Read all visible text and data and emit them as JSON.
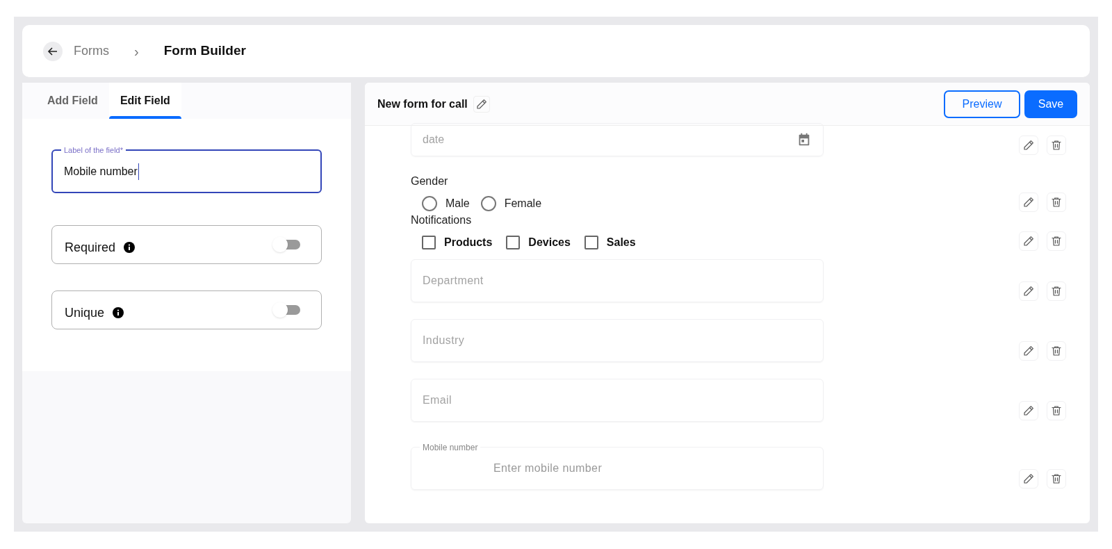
{
  "breadcrumb": {
    "parent": "Forms",
    "separator": "›",
    "current": "Form Builder"
  },
  "tabs": [
    {
      "label": "Add Field",
      "selected": false
    },
    {
      "label": "Edit Field",
      "selected": true
    }
  ],
  "label_field": {
    "label": "Label of the field*",
    "value": "Mobile number"
  },
  "toggles": [
    {
      "label": "Required",
      "on": false
    },
    {
      "label": "Unique",
      "on": false
    }
  ],
  "form": {
    "title": "New form for call",
    "preview": "Preview",
    "save": "Save"
  },
  "fields": [
    {
      "kind": "date",
      "placeholder": "date"
    },
    {
      "kind": "radio",
      "label": "Gender",
      "options": [
        {
          "label": "Male",
          "selected": false
        },
        {
          "label": "Female",
          "selected": false
        }
      ]
    },
    {
      "kind": "checkbox",
      "label": "Notifications",
      "options": [
        {
          "label": "Products",
          "checked": false
        },
        {
          "label": "Devices",
          "checked": false
        },
        {
          "label": "Sales",
          "checked": false
        }
      ]
    },
    {
      "kind": "text",
      "placeholder": "Department"
    },
    {
      "kind": "text",
      "placeholder": "Industry"
    },
    {
      "kind": "text",
      "placeholder": "Email"
    },
    {
      "kind": "phone",
      "label": "Mobile number",
      "placeholder": "Enter mobile number"
    }
  ]
}
